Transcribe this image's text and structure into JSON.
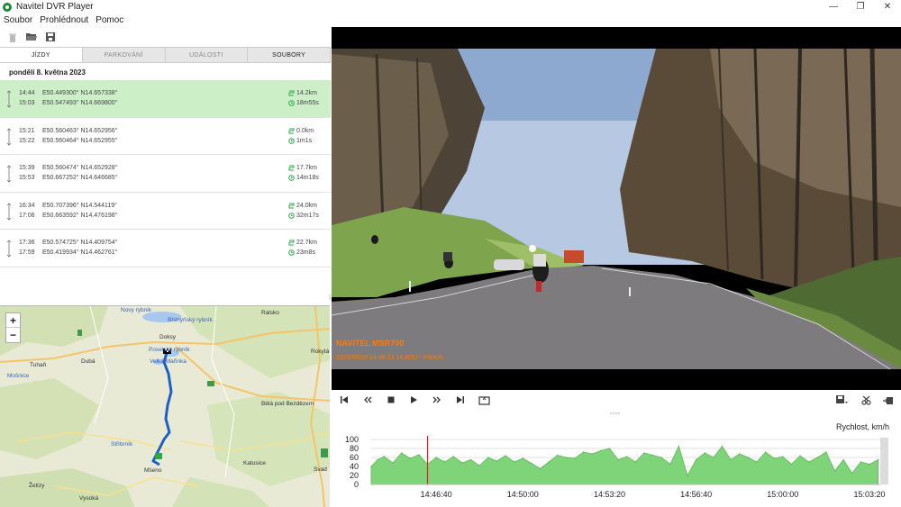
{
  "window": {
    "title": "Navitel DVR Player",
    "minimize": "—",
    "maximize": "❐",
    "close": "✕"
  },
  "menu": {
    "items": [
      "Soubor",
      "Prohlédnout",
      "Pomoc"
    ]
  },
  "toolbar": {
    "icons": [
      "trash-icon",
      "folder-open-icon",
      "save-icon"
    ]
  },
  "tabs": [
    "JÍZDY",
    "PARKOVÁNÍ",
    "UDÁLOSTI",
    "SOUBORY"
  ],
  "date_header": "pondělí 8. května 2023",
  "trips": [
    {
      "start_time": "14:44",
      "end_time": "15:03",
      "start_coords": "E50.449300° N14.657338°",
      "end_coords": "E50.547493° N14.669800°",
      "distance": "14.2km",
      "duration": "18m55s",
      "selected": true
    },
    {
      "start_time": "15:21",
      "end_time": "15:22",
      "start_coords": "E50.560463° N14.652956°",
      "end_coords": "E50.560464° N14.652955°",
      "distance": "0.0km",
      "duration": "1m1s",
      "selected": false
    },
    {
      "start_time": "15:39",
      "end_time": "15:53",
      "start_coords": "E50.560474° N14.652928°",
      "end_coords": "E50.667252° N14.646685°",
      "distance": "17.7km",
      "duration": "14m18s",
      "selected": false
    },
    {
      "start_time": "16:34",
      "end_time": "17:06",
      "start_coords": "E50.707396° N14.544119°",
      "end_coords": "E50.663592° N14.476198°",
      "distance": "24.0km",
      "duration": "32m17s",
      "selected": false
    },
    {
      "start_time": "17:36",
      "end_time": "17:59",
      "start_coords": "E50.574725° N14.409754°",
      "end_coords": "E50.419934° N14.462761°",
      "distance": "22.7km",
      "duration": "23m8s",
      "selected": false
    }
  ],
  "map": {
    "zoom_in": "+",
    "zoom_out": "−",
    "places": [
      {
        "name": "Novy rybnik",
        "blue": true
      },
      {
        "name": "Břehyňský rybník",
        "blue": true
      },
      {
        "name": "Ralsko",
        "blue": false
      },
      {
        "name": "Doksy",
        "blue": false
      },
      {
        "name": "Poselský rybník",
        "blue": true
      },
      {
        "name": "Velká Mařinka",
        "blue": true
      },
      {
        "name": "Rokytá",
        "blue": false
      },
      {
        "name": "Tuhaň",
        "blue": false
      },
      {
        "name": "Dubá",
        "blue": false
      },
      {
        "name": "Mošnice",
        "blue": true
      },
      {
        "name": "Bělá pod Bezdězem",
        "blue": false
      },
      {
        "name": "Střibrník",
        "blue": true
      },
      {
        "name": "Katusice",
        "blue": false
      },
      {
        "name": "Mšeno",
        "blue": false
      },
      {
        "name": "Želízy",
        "blue": false
      },
      {
        "name": "Vysoká",
        "blue": false
      },
      {
        "name": "Svad",
        "blue": false
      }
    ]
  },
  "video": {
    "overlay_brand": "NAVITEL MSR700",
    "overlay_info": "2023/05/08 14:46:33  14.4857°  45km/h"
  },
  "controls": {
    "left": [
      "skip-start-icon",
      "rewind-icon",
      "stop-icon",
      "play-icon",
      "fast-forward-icon",
      "skip-end-icon",
      "screenshot-icon"
    ],
    "right": [
      "save-icon",
      "cut-icon",
      "export-icon"
    ]
  },
  "chart_data": {
    "type": "area",
    "title": "Rychlost, km/h",
    "ylim": [
      0,
      100
    ],
    "yticks": [
      0,
      20,
      40,
      60,
      80,
      100
    ],
    "xticks": [
      "14:46:40",
      "14:50:00",
      "14:53:20",
      "14:56:40",
      "15:00:00",
      "15:03:20"
    ],
    "grid": true,
    "color": "#7fd47a",
    "x_start": "14:44:10",
    "x_end": "15:03:45",
    "cursor_time": "14:46:20",
    "x": [
      "14:44:10",
      "14:44:25",
      "14:44:40",
      "14:45:00",
      "14:45:20",
      "14:45:40",
      "14:46:00",
      "14:46:20",
      "14:46:40",
      "14:47:00",
      "14:47:20",
      "14:47:40",
      "14:48:00",
      "14:48:20",
      "14:48:40",
      "14:49:00",
      "14:49:20",
      "14:49:40",
      "14:50:00",
      "14:50:20",
      "14:50:40",
      "14:51:00",
      "14:51:20",
      "14:51:40",
      "14:52:00",
      "14:52:20",
      "14:52:40",
      "14:53:00",
      "14:53:20",
      "14:53:40",
      "14:54:00",
      "14:54:20",
      "14:54:40",
      "14:55:00",
      "14:55:20",
      "14:55:40",
      "14:56:00",
      "14:56:20",
      "14:56:40",
      "14:57:00",
      "14:57:20",
      "14:57:40",
      "14:58:00",
      "14:58:20",
      "14:58:40",
      "14:59:00",
      "14:59:20",
      "14:59:40",
      "15:00:00",
      "15:00:20",
      "15:00:40",
      "15:01:00",
      "15:01:20",
      "15:01:40",
      "15:02:00",
      "15:02:20",
      "15:02:40",
      "15:03:00",
      "15:03:20",
      "15:03:40"
    ],
    "values": [
      40,
      55,
      62,
      48,
      70,
      58,
      66,
      45,
      60,
      50,
      62,
      48,
      55,
      42,
      60,
      52,
      64,
      50,
      58,
      47,
      35,
      50,
      65,
      60,
      58,
      72,
      68,
      75,
      80,
      55,
      62,
      50,
      70,
      65,
      60,
      45,
      85,
      20,
      55,
      70,
      60,
      85,
      55,
      68,
      60,
      50,
      72,
      58,
      62,
      45,
      64,
      50,
      60,
      72,
      30,
      55,
      25,
      50,
      45,
      55
    ]
  }
}
